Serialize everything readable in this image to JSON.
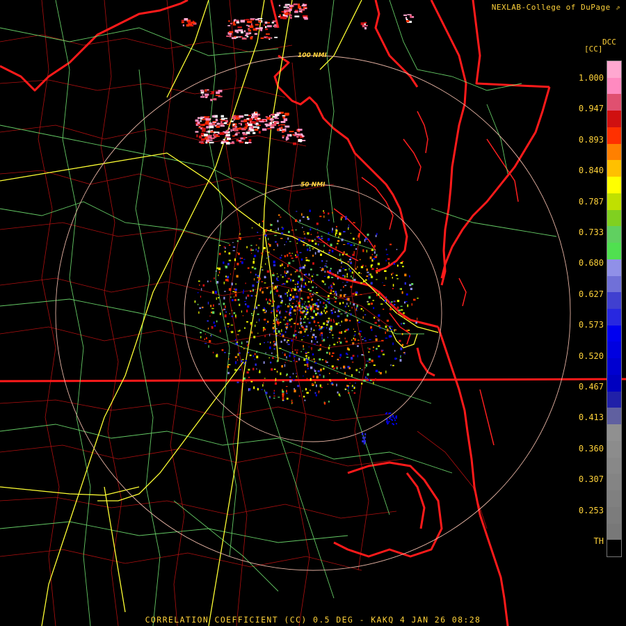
{
  "header": {
    "brand": "NEXLAB-College of DuPage",
    "brand_icon": "external-link-icon"
  },
  "footer": {
    "product_line": "CORRELATION COEFFICIENT (CC) 0.5 DEG - KAKQ 4 JAN 26 08:28"
  },
  "map": {
    "range_rings": [
      {
        "label": "50 NMI"
      },
      {
        "label": "100 NMI"
      }
    ],
    "colors": {
      "state_borders": "#ff1a1a",
      "county_borders": "#b01010",
      "highways": "#ffff33",
      "roads": "#70e070",
      "range_rings": "#e6b3a3"
    }
  },
  "legend": {
    "title": "DCC",
    "units": "[CC]",
    "labels": [
      "1.000",
      "0.947",
      "0.893",
      "0.840",
      "0.787",
      "0.733",
      "0.680",
      "0.627",
      "0.573",
      "0.520",
      "0.467",
      "0.413",
      "0.360",
      "0.307",
      "0.253",
      "TH"
    ],
    "colorbar": [
      "#ffa8d0",
      "#ff8ac0",
      "#e05070",
      "#d01010",
      "#ff3000",
      "#ff8000",
      "#ffc000",
      "#ffff00",
      "#c0e000",
      "#80d020",
      "#60d060",
      "#50e050",
      "#9090e8",
      "#7070d8",
      "#4040d0",
      "#2828e0",
      "#0000f0",
      "#0000e0",
      "#0000d0",
      "#0000c0",
      "#2020a8",
      "#6060a0",
      "#909090",
      "#8c8c8c",
      "#888888",
      "#848484",
      "#808080",
      "#7c7c7c",
      "#787878",
      "#000000"
    ]
  }
}
